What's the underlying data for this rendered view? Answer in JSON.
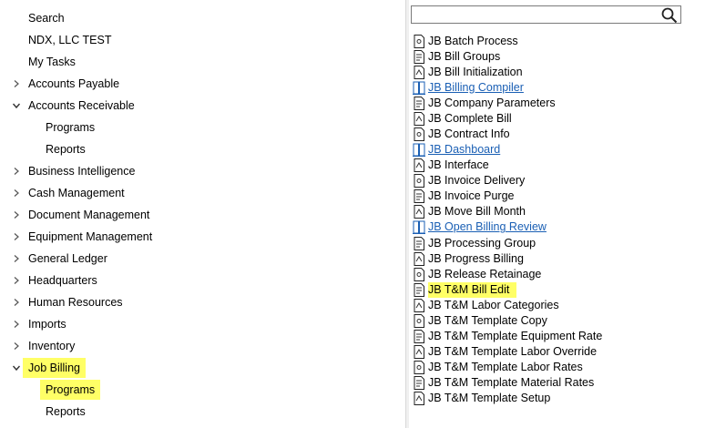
{
  "nav": {
    "items": [
      {
        "label": "Search",
        "indent": 0,
        "chevron": "none"
      },
      {
        "label": "NDX, LLC TEST",
        "indent": 0,
        "chevron": "none"
      },
      {
        "label": "My Tasks",
        "indent": 0,
        "chevron": "none"
      },
      {
        "label": "Accounts Payable",
        "indent": 0,
        "chevron": "right"
      },
      {
        "label": "Accounts Receivable",
        "indent": 0,
        "chevron": "down"
      },
      {
        "label": "Programs",
        "indent": 1,
        "chevron": "none"
      },
      {
        "label": "Reports",
        "indent": 1,
        "chevron": "none"
      },
      {
        "label": "Business Intelligence",
        "indent": 0,
        "chevron": "right"
      },
      {
        "label": "Cash Management",
        "indent": 0,
        "chevron": "right"
      },
      {
        "label": "Document Management",
        "indent": 0,
        "chevron": "right"
      },
      {
        "label": "Equipment Management",
        "indent": 0,
        "chevron": "right"
      },
      {
        "label": "General Ledger",
        "indent": 0,
        "chevron": "right"
      },
      {
        "label": "Headquarters",
        "indent": 0,
        "chevron": "right"
      },
      {
        "label": "Human Resources",
        "indent": 0,
        "chevron": "right"
      },
      {
        "label": "Imports",
        "indent": 0,
        "chevron": "right"
      },
      {
        "label": "Inventory",
        "indent": 0,
        "chevron": "right"
      },
      {
        "label": "Job Billing",
        "indent": 0,
        "chevron": "down",
        "highlight": true
      },
      {
        "label": "Programs",
        "indent": 1,
        "chevron": "none",
        "highlight": true
      },
      {
        "label": "Reports",
        "indent": 1,
        "chevron": "none"
      }
    ]
  },
  "search": {
    "value": "",
    "placeholder": "",
    "icon": "search-icon"
  },
  "programs": [
    {
      "label": "JB Batch Process",
      "type": "program"
    },
    {
      "label": "JB Bill Groups",
      "type": "program"
    },
    {
      "label": "JB Bill Initialization",
      "type": "program"
    },
    {
      "label": "JB Billing Compiler",
      "type": "link"
    },
    {
      "label": "JB Company Parameters",
      "type": "program"
    },
    {
      "label": "JB Complete Bill",
      "type": "program"
    },
    {
      "label": "JB Contract Info",
      "type": "program"
    },
    {
      "label": "JB Dashboard",
      "type": "link"
    },
    {
      "label": "JB Interface",
      "type": "program"
    },
    {
      "label": "JB Invoice Delivery",
      "type": "program"
    },
    {
      "label": "JB Invoice Purge",
      "type": "program"
    },
    {
      "label": "JB Move Bill Month",
      "type": "program"
    },
    {
      "label": "JB Open Billing Review",
      "type": "link"
    },
    {
      "label": "JB Processing Group",
      "type": "program"
    },
    {
      "label": "JB Progress Billing",
      "type": "program"
    },
    {
      "label": "JB Release Retainage",
      "type": "program"
    },
    {
      "label": "JB T&M Bill Edit",
      "type": "program",
      "highlight": true
    },
    {
      "label": "JB T&M Labor Categories",
      "type": "program"
    },
    {
      "label": "JB T&M Template Copy",
      "type": "program"
    },
    {
      "label": "JB T&M Template Equipment Rate",
      "type": "program"
    },
    {
      "label": "JB T&M Template Labor Override",
      "type": "program"
    },
    {
      "label": "JB T&M Template Labor Rates",
      "type": "program"
    },
    {
      "label": "JB T&M Template Material Rates",
      "type": "program"
    },
    {
      "label": "JB T&M Template Setup",
      "type": "program"
    }
  ],
  "colors": {
    "highlight": "#ffff66",
    "link": "#1a5fb4"
  }
}
